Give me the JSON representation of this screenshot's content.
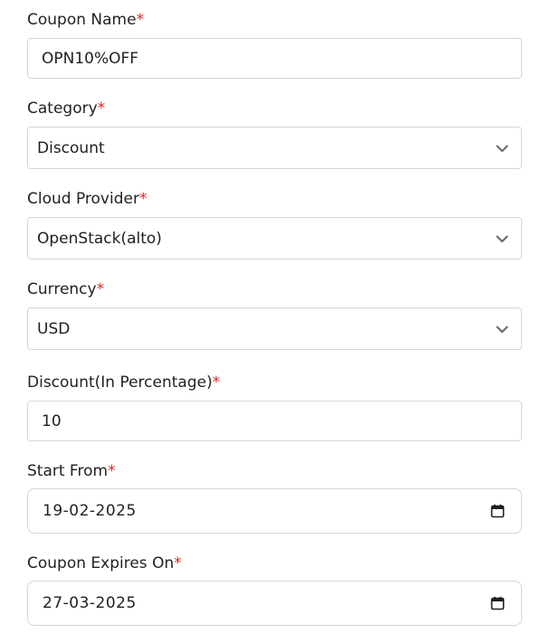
{
  "form": {
    "coupon_name": {
      "label": "Coupon Name",
      "required_mark": "*",
      "value": "OPN10%OFF"
    },
    "category": {
      "label": "Category",
      "required_mark": "*",
      "value": "Discount",
      "icon": "chevron-down-icon"
    },
    "cloud_provider": {
      "label": "Cloud Provider",
      "required_mark": "*",
      "value": "OpenStack(alto)",
      "icon": "chevron-down-icon"
    },
    "currency": {
      "label": "Currency",
      "required_mark": "*",
      "value": "USD",
      "icon": "chevron-down-icon"
    },
    "discount": {
      "label": "Discount(In Percentage)",
      "required_mark": "*",
      "value": "10"
    },
    "start_from": {
      "label": "Start From",
      "required_mark": "*",
      "value": "19-02-2025",
      "icon": "calendar-icon"
    },
    "expires_on": {
      "label": "Coupon Expires On",
      "required_mark": "*",
      "value": "27-03-2025",
      "icon": "calendar-icon"
    }
  },
  "colors": {
    "required": "#e02424",
    "border": "#d3d6da",
    "text": "#1f1f1f",
    "icon": "#6b6f75"
  }
}
